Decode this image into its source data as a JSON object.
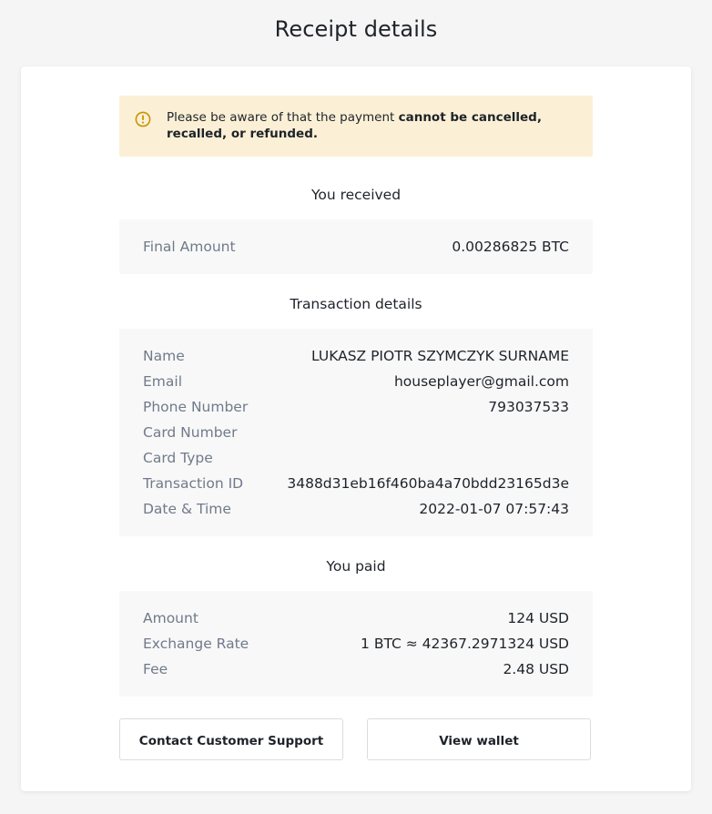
{
  "page": {
    "title": "Receipt details"
  },
  "warning": {
    "icon": "warning-circle-icon",
    "text_prefix": "Please be aware of that the payment ",
    "text_bold": "cannot be cancelled, recalled, or refunded."
  },
  "received": {
    "title": "You received",
    "rows": [
      {
        "label": "Final Amount",
        "value": "0.00286825 BTC"
      }
    ]
  },
  "transaction": {
    "title": "Transaction details",
    "rows": [
      {
        "label": "Name",
        "value": "LUKASZ PIOTR SZYMCZYK SURNAME"
      },
      {
        "label": "Email",
        "value": "houseplayer@gmail.com"
      },
      {
        "label": "Phone Number",
        "value": "793037533"
      },
      {
        "label": "Card Number",
        "value": ""
      },
      {
        "label": "Card Type",
        "value": ""
      },
      {
        "label": "Transaction ID",
        "value": "3488d31eb16f460ba4a70bdd23165d3e"
      },
      {
        "label": "Date & Time",
        "value": "2022-01-07 07:57:43"
      }
    ]
  },
  "paid": {
    "title": "You paid",
    "rows": [
      {
        "label": "Amount",
        "value": "124 USD"
      },
      {
        "label": "Exchange Rate",
        "value": "1 BTC ≈ 42367.2971324 USD"
      },
      {
        "label": "Fee",
        "value": "2.48 USD"
      }
    ]
  },
  "buttons": {
    "support_label": "Contact Customer Support",
    "wallet_label": "View wallet"
  },
  "colors": {
    "background": "#f5f5f5",
    "card": "#ffffff",
    "warning_bg": "#fbf0d6",
    "warning_icon": "#c99400",
    "label": "#707a8a",
    "text": "#1e2329",
    "box_bg": "#f8f8f8"
  }
}
